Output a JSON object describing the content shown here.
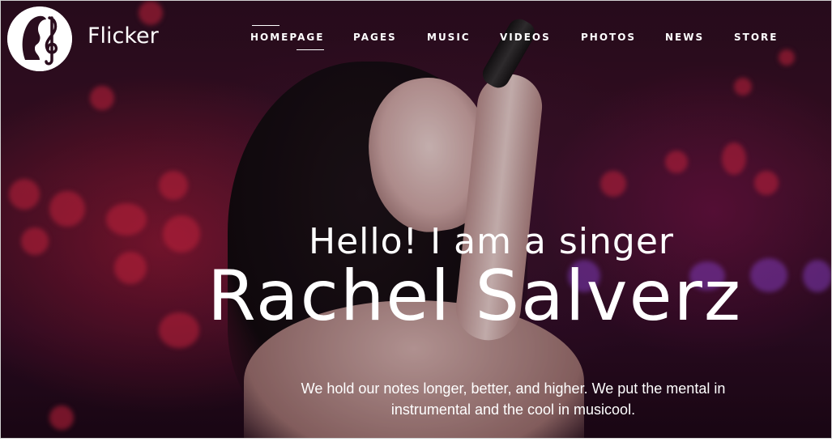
{
  "brand": {
    "name": "Flicker",
    "logo_icon": "singer-treble-clef-logo",
    "accent": "#ffffff"
  },
  "nav": {
    "items": [
      {
        "label": "HOMEPAGE",
        "active": true
      },
      {
        "label": "PAGES",
        "active": false
      },
      {
        "label": "MUSIC",
        "active": false
      },
      {
        "label": "VIDEOS",
        "active": false
      },
      {
        "label": "PHOTOS",
        "active": false
      },
      {
        "label": "NEWS",
        "active": false
      },
      {
        "label": "STORE",
        "active": false
      }
    ]
  },
  "hero": {
    "headline": "Hello! I am a singer",
    "name": "Rachel Salverz",
    "tagline_line1": "We hold our notes longer, better, and higher. We put the mental in",
    "tagline_line2": "instrumental and the cool in musicool.",
    "background_color": "#2a0d1e"
  }
}
